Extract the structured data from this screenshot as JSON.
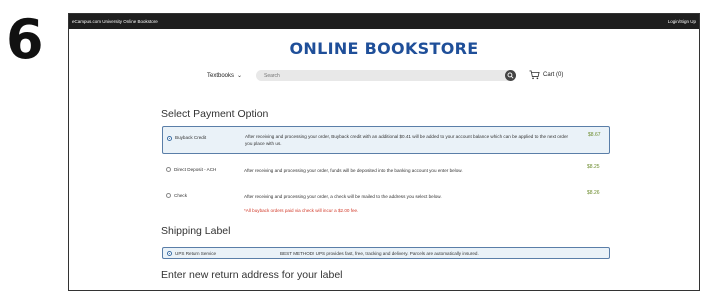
{
  "step_number": "6",
  "topbar": {
    "site_name": "eCampus.com University Online Bookstore",
    "login_label": "Login/Sign Up"
  },
  "header": {
    "title": "ONLINE BOOKSTORE"
  },
  "nav": {
    "textbooks_label": "Textbooks",
    "search_placeholder": "Search",
    "cart_label": "Cart (0)"
  },
  "payment": {
    "heading": "Select Payment Option",
    "options": [
      {
        "label": "Buyback Credit",
        "description": "After receiving and processing your order, Buyback credit with an additional $0.41 will be added to your account balance which can be applied to the next order you place with us.",
        "amount": "$8.67",
        "selected": true
      },
      {
        "label": "Direct Deposit - ACH",
        "description": "After receiving and processing your order, funds will be deposited into the banking account you enter below.",
        "amount": "$8.25",
        "selected": false
      },
      {
        "label": "Check",
        "description": "After receiving and processing your order, a check will be mailed to the address you select below.",
        "amount": "$8.26",
        "selected": false
      }
    ],
    "warning": "*All buyback orders paid via check will incur a $2.00 fee."
  },
  "shipping": {
    "heading": "Shipping Label",
    "option_label": "UPS Return Service",
    "option_description": "BEST METHOD! UPS provides fast, free, tracking and delivery. Parcels are automatically insured."
  },
  "return_address": {
    "heading": "Enter new return address for your label"
  },
  "colors": {
    "brand_blue": "#1f4f99",
    "selected_bg": "#eaf2f8",
    "selected_border": "#5a7ea8",
    "amount_green": "#6a8a2a",
    "warning_red": "#d23a2a",
    "topbar_bg": "#1e1e1e"
  }
}
